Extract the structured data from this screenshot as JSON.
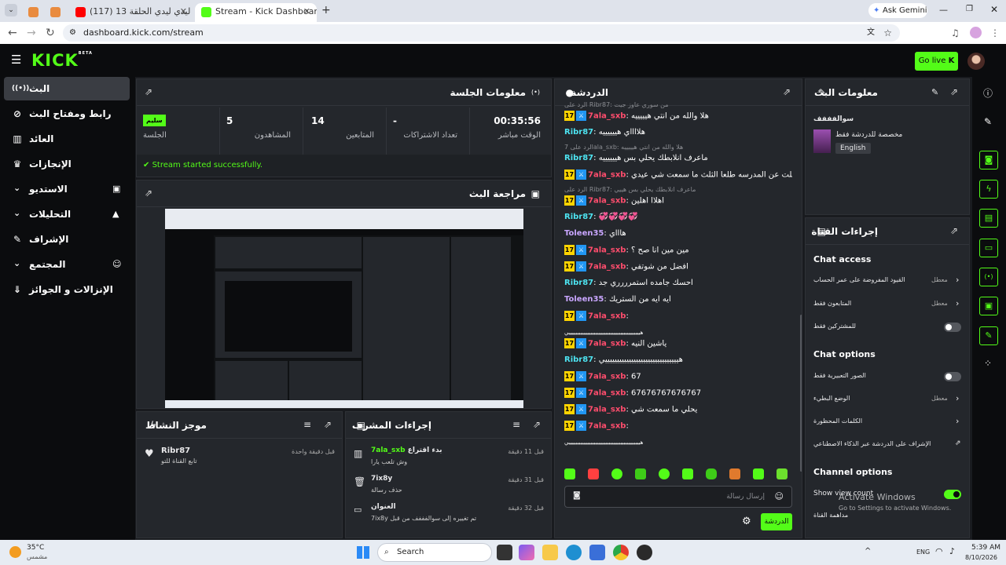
{
  "browser": {
    "tabs": [
      {
        "label": "",
        "favicon_color": "#e98b3f"
      },
      {
        "label": "",
        "favicon_color": "#e98b3f"
      },
      {
        "label": "(117) ليدي ليدي الحلقة 13 - ube",
        "favicon_color": "#ff0000"
      },
      {
        "label": "Stream - Kick Dashboard",
        "favicon_color": "#53fc18"
      }
    ],
    "new_tab": "+",
    "ask_gemini": "Ask Gemini",
    "url": "dashboard.kick.com/stream"
  },
  "header": {
    "logo": "KICK",
    "logo_beta": "BETA",
    "go_live": "Go live"
  },
  "sidebar": {
    "items": [
      {
        "label": "البث",
        "icon": "((•))"
      },
      {
        "label": "رابط ومفتاح البث",
        "icon": "⊘"
      },
      {
        "label": "العائد",
        "icon": "▥"
      },
      {
        "label": "الإنجازات",
        "icon": "🏆"
      },
      {
        "label": "الاستديو",
        "icon": "⌄"
      },
      {
        "label": "التحليلات",
        "icon": "⌄"
      },
      {
        "label": "الإشراف",
        "icon": "✎"
      },
      {
        "label": "المجتمع",
        "icon": "⌄"
      },
      {
        "label": "الإنزالات و الجوائز",
        "icon": "⇓"
      }
    ]
  },
  "session": {
    "title": "معلومات الجلسة",
    "status_badge": "سليم",
    "stats": [
      {
        "value": "00:35:56",
        "label": "الوقت مباشر"
      },
      {
        "value": "-",
        "label": "تعداد الاشتراكات"
      },
      {
        "value": "14",
        "label": "المتابعين"
      },
      {
        "value": "5",
        "label": "المشاهدون"
      },
      {
        "value": "",
        "label": "الجلسة"
      }
    ],
    "success": "Stream started successfully."
  },
  "preview": {
    "title": "مراجعة البث"
  },
  "activity": {
    "title": "موجز النشاط",
    "items": [
      {
        "user": "Ribr87",
        "text": "تابع القناة للتو",
        "time": "قبل دقيقة واحدة"
      }
    ]
  },
  "modactions": {
    "title": "إجراءات المشرف",
    "items": [
      {
        "user": "7ala_sxb",
        "action": "بدء اقتراع",
        "sub": "وش تلعب يارا",
        "time": "قبل 11 دقيقة"
      },
      {
        "user": "7ix8y",
        "action": "",
        "sub": "حذف رسالة",
        "time": "قبل 31 دقيقة"
      },
      {
        "user": "العنوان",
        "action": "",
        "sub": "7ix8y تم تغييره إلى سوالفففف من قبل",
        "time": "قبل 32 دقيقة"
      }
    ]
  },
  "chat": {
    "title": "الدردشة",
    "messages": [
      {
        "type": "reply",
        "text": "الرد على Ribr87: من سوري عاوز جيت"
      },
      {
        "type": "msg",
        "badges": true,
        "user": "7ala_sxb",
        "color": "#ff4d6d",
        "text": "هلا والله من انتي هيييييه"
      },
      {
        "type": "msg",
        "badges": false,
        "user": "Ribr87",
        "color": "#4de3f0",
        "text": "هلااااي هييييييه"
      },
      {
        "type": "reply",
        "text": "الرد على 7ala_sxb: هلا والله من انتي هيييييه"
      },
      {
        "type": "msg",
        "badges": false,
        "user": "Ribr87",
        "color": "#4de3f0",
        "text": "ماعرف انلابطك يحلي بس هييييييه"
      },
      {
        "type": "msg",
        "badges": true,
        "user": "7ala_sxb",
        "color": "#ff4d6d",
        "text": "اول ما ارسلت عن المدرسه طلعا الثلث ما سمعت شي عيدي"
      },
      {
        "type": "reply",
        "text": "الرد على Ribr87: ماعرف انلابطك يحلي بس هييي"
      },
      {
        "type": "msg",
        "badges": true,
        "user": "7ala_sxb",
        "color": "#ff4d6d",
        "text": "اهلاا اهلين"
      },
      {
        "type": "msg",
        "badges": false,
        "user": "Ribr87",
        "color": "#4de3f0",
        "text": "💞💞💞💞"
      },
      {
        "type": "msg",
        "badges": false,
        "user": "Toleen35",
        "color": "#c9a6ff",
        "text": "هاااي"
      },
      {
        "type": "msg",
        "badges": true,
        "user": "7ala_sxb",
        "color": "#ff4d6d",
        "text": "مين مين انا صح ؟"
      },
      {
        "type": "msg",
        "badges": true,
        "user": "7ala_sxb",
        "color": "#ff4d6d",
        "text": "افضل من شوتفي"
      },
      {
        "type": "msg",
        "badges": false,
        "user": "Ribr87",
        "color": "#4de3f0",
        "text": "احسك جامده استمرررري جد"
      },
      {
        "type": "msg",
        "badges": false,
        "user": "Toleen35",
        "color": "#c9a6ff",
        "text": "ايه ايه من الستريك"
      },
      {
        "type": "msg",
        "badges": true,
        "user": "7ala_sxb",
        "color": "#ff4d6d",
        "text": ""
      },
      {
        "type": "cont",
        "text": "هيييييييييييييييييييييييييييييييييييييييييييي"
      },
      {
        "type": "msg",
        "badges": true,
        "user": "7ala_sxb",
        "color": "#ff4d6d",
        "text": "ياشين النيه"
      },
      {
        "type": "msg",
        "badges": false,
        "user": "Ribr87",
        "color": "#4de3f0",
        "text": "هيييييييييييييييييييييييييييييييي"
      },
      {
        "type": "msg",
        "badges": true,
        "user": "7ala_sxb",
        "color": "#ff4d6d",
        "text": "67"
      },
      {
        "type": "msg",
        "badges": true,
        "user": "7ala_sxb",
        "color": "#ff4d6d",
        "text": "67676767676767"
      },
      {
        "type": "msg",
        "badges": true,
        "user": "7ala_sxb",
        "color": "#ff4d6d",
        "text": "يحلي ما سمعت شي"
      },
      {
        "type": "msg",
        "badges": true,
        "user": "7ala_sxb",
        "color": "#ff4d6d",
        "text": ""
      },
      {
        "type": "cont",
        "text": "هيييييييييييييييييييييييييييييييييييييييييييي"
      }
    ],
    "placeholder": "إرسال رسالة",
    "send_label": "الدردشة"
  },
  "streaminfo": {
    "title": "معلومات البث",
    "stream_title": "سوالفففف",
    "category": "مخصصة للدردشة فقط",
    "language": "English"
  },
  "channel_actions": {
    "title": "إجراءات القناة",
    "chat_access": "Chat access",
    "access_rows": [
      {
        "label": "القيود المفروضة على عمر الحساب",
        "value": "معطل",
        "control": "chevron"
      },
      {
        "label": "المتابعون فقط",
        "value": "معطل",
        "control": "chevron"
      },
      {
        "label": "للمشتركين فقط",
        "value": "",
        "control": "toggle-off"
      }
    ],
    "chat_options": "Chat options",
    "option_rows": [
      {
        "label": "الصور التعبيرية فقط",
        "value": "",
        "control": "toggle-off"
      },
      {
        "label": "الوضع البطيء",
        "value": "معطل",
        "control": "chevron"
      },
      {
        "label": "الكلمات المحظورة",
        "value": "",
        "control": "chevron"
      },
      {
        "label": "الإشراف على الدردشة عبر الذكاء الاصطناعي",
        "value": "",
        "control": "external"
      }
    ],
    "channel_options": "Channel options",
    "show_view_count": "Show view count",
    "channel_sub": "مداهمة القناة",
    "activate_title": "Activate Windows",
    "activate_sub": "Go to Settings to activate Windows."
  },
  "taskbar": {
    "weather_temp": "35°C",
    "weather_desc": "مشمس",
    "search": "Search",
    "lang": "ENG",
    "time": "5:39 AM",
    "date": "8/10/2026"
  }
}
